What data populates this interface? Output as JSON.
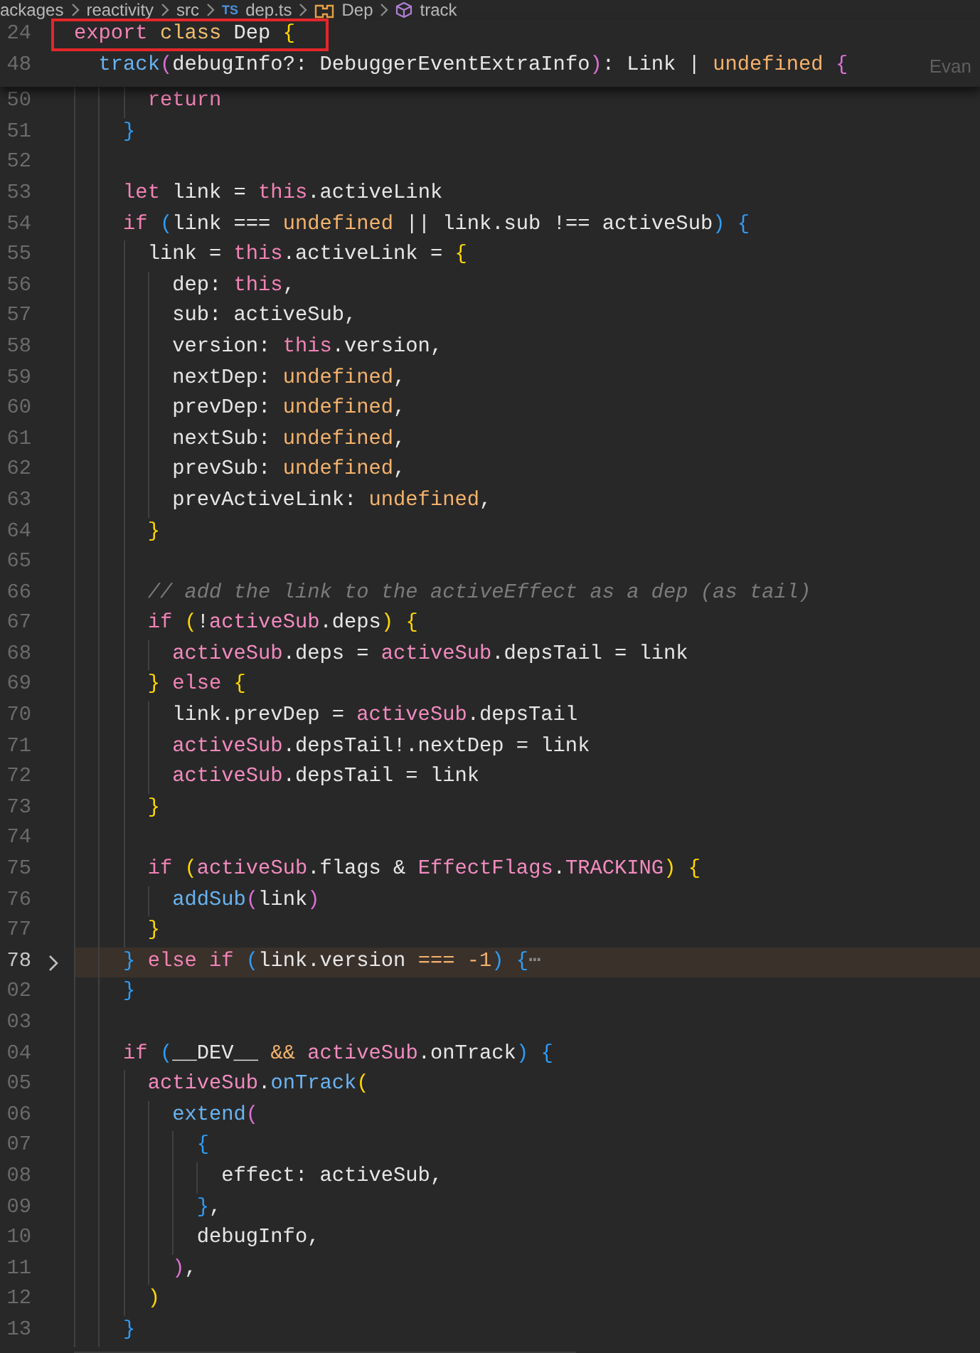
{
  "breadcrumb": [
    {
      "label": "ackages",
      "kind": "folder"
    },
    {
      "label": "reactivity",
      "kind": "folder"
    },
    {
      "label": "src",
      "kind": "folder"
    },
    {
      "label": "dep.ts",
      "kind": "file",
      "badge": "TS"
    },
    {
      "label": "Dep",
      "kind": "class"
    },
    {
      "label": "track",
      "kind": "method"
    }
  ],
  "sticky_lines": [
    {
      "number": "24",
      "boxed": true,
      "tokens": [
        {
          "text": "export ",
          "kind": "kw"
        },
        {
          "text": "class ",
          "kind": "st"
        },
        {
          "text": "Dep ",
          "kind": "p"
        },
        {
          "text": "{",
          "kind": "b1"
        }
      ]
    },
    {
      "number": "48",
      "boxed": false,
      "blame": "Evan",
      "tokens": [
        {
          "text": "  track",
          "kind": "fn"
        },
        {
          "text": "(",
          "kind": "b2"
        },
        {
          "text": "debugInfo?: DebuggerEventExtraInfo",
          "kind": "p"
        },
        {
          "text": ")",
          "kind": "b2"
        },
        {
          "text": ": Link | ",
          "kind": "p"
        },
        {
          "text": "undefined ",
          "kind": "c"
        },
        {
          "text": "{",
          "kind": "b2"
        }
      ]
    }
  ],
  "lines": [
    {
      "number": "50",
      "folded": false,
      "current": false,
      "tokens": [
        {
          "text": "      return",
          "kind": "kw"
        }
      ]
    },
    {
      "number": "51",
      "folded": false,
      "current": false,
      "tokens": [
        {
          "text": "    }",
          "kind": "b3"
        }
      ]
    },
    {
      "number": "52",
      "folded": false,
      "current": false
    },
    {
      "number": "53",
      "folded": false,
      "current": false,
      "tokens": [
        {
          "text": "    let ",
          "kind": "kw"
        },
        {
          "text": "link = ",
          "kind": "p"
        },
        {
          "text": "this",
          "kind": "kw"
        },
        {
          "text": ".activeLink",
          "kind": "p"
        }
      ]
    },
    {
      "number": "54",
      "folded": false,
      "current": false,
      "tokens": [
        {
          "text": "    if ",
          "kind": "kw"
        },
        {
          "text": "(",
          "kind": "b3"
        },
        {
          "text": "link === ",
          "kind": "p"
        },
        {
          "text": "undefined",
          "kind": "c"
        },
        {
          "text": " || link.sub !== activeSub",
          "kind": "p"
        },
        {
          "text": ") {",
          "kind": "b3"
        }
      ]
    },
    {
      "number": "55",
      "folded": false,
      "current": false,
      "tokens": [
        {
          "text": "      link = ",
          "kind": "p"
        },
        {
          "text": "this",
          "kind": "kw"
        },
        {
          "text": ".activeLink = ",
          "kind": "p"
        },
        {
          "text": "{",
          "kind": "b1"
        }
      ]
    },
    {
      "number": "56",
      "folded": false,
      "current": false,
      "tokens": [
        {
          "text": "        dep: ",
          "kind": "p"
        },
        {
          "text": "this",
          "kind": "kw"
        },
        {
          "text": ",",
          "kind": "p"
        }
      ]
    },
    {
      "number": "57",
      "folded": false,
      "current": false,
      "tokens": [
        {
          "text": "        sub: activeSub,",
          "kind": "p"
        }
      ]
    },
    {
      "number": "58",
      "folded": false,
      "current": false,
      "tokens": [
        {
          "text": "        version: ",
          "kind": "p"
        },
        {
          "text": "this",
          "kind": "kw"
        },
        {
          "text": ".version,",
          "kind": "p"
        }
      ]
    },
    {
      "number": "59",
      "folded": false,
      "current": false,
      "tokens": [
        {
          "text": "        nextDep: ",
          "kind": "p"
        },
        {
          "text": "undefined",
          "kind": "c"
        },
        {
          "text": ",",
          "kind": "p"
        }
      ]
    },
    {
      "number": "60",
      "folded": false,
      "current": false,
      "tokens": [
        {
          "text": "        prevDep: ",
          "kind": "p"
        },
        {
          "text": "undefined",
          "kind": "c"
        },
        {
          "text": ",",
          "kind": "p"
        }
      ]
    },
    {
      "number": "61",
      "folded": false,
      "current": false,
      "tokens": [
        {
          "text": "        nextSub: ",
          "kind": "p"
        },
        {
          "text": "undefined",
          "kind": "c"
        },
        {
          "text": ",",
          "kind": "p"
        }
      ]
    },
    {
      "number": "62",
      "folded": false,
      "current": false,
      "tokens": [
        {
          "text": "        prevSub: ",
          "kind": "p"
        },
        {
          "text": "undefined",
          "kind": "c"
        },
        {
          "text": ",",
          "kind": "p"
        }
      ]
    },
    {
      "number": "63",
      "folded": false,
      "current": false,
      "tokens": [
        {
          "text": "        prevActiveLink: ",
          "kind": "p"
        },
        {
          "text": "undefined",
          "kind": "c"
        },
        {
          "text": ",",
          "kind": "p"
        }
      ]
    },
    {
      "number": "64",
      "folded": false,
      "current": false,
      "tokens": [
        {
          "text": "      }",
          "kind": "b1"
        }
      ]
    },
    {
      "number": "65",
      "folded": false,
      "current": false
    },
    {
      "number": "66",
      "folded": false,
      "current": false,
      "tokens": [
        {
          "text": "      // add the link to the activeEffect as a dep (as tail)",
          "kind": "cm"
        }
      ]
    },
    {
      "number": "67",
      "folded": false,
      "current": false,
      "tokens": [
        {
          "text": "      if ",
          "kind": "kw"
        },
        {
          "text": "(",
          "kind": "b1"
        },
        {
          "text": "!",
          "kind": "p"
        },
        {
          "text": "activeSub",
          "kind": "v"
        },
        {
          "text": ".deps",
          "kind": "p"
        },
        {
          "text": ") {",
          "kind": "b1"
        }
      ]
    },
    {
      "number": "68",
      "folded": false,
      "current": false,
      "tokens": [
        {
          "text": "        activeSub",
          "kind": "v"
        },
        {
          "text": ".deps = ",
          "kind": "p"
        },
        {
          "text": "activeSub",
          "kind": "v"
        },
        {
          "text": ".depsTail = link",
          "kind": "p"
        }
      ]
    },
    {
      "number": "69",
      "folded": false,
      "current": false,
      "tokens": [
        {
          "text": "      } ",
          "kind": "b1"
        },
        {
          "text": "else ",
          "kind": "kw"
        },
        {
          "text": "{",
          "kind": "b1"
        }
      ]
    },
    {
      "number": "70",
      "folded": false,
      "current": false,
      "tokens": [
        {
          "text": "        link.prevDep = ",
          "kind": "p"
        },
        {
          "text": "activeSub",
          "kind": "v"
        },
        {
          "text": ".depsTail",
          "kind": "p"
        }
      ]
    },
    {
      "number": "71",
      "folded": false,
      "current": false,
      "tokens": [
        {
          "text": "        activeSub",
          "kind": "v"
        },
        {
          "text": ".depsTail!.nextDep = link",
          "kind": "p"
        }
      ]
    },
    {
      "number": "72",
      "folded": false,
      "current": false,
      "tokens": [
        {
          "text": "        activeSub",
          "kind": "v"
        },
        {
          "text": ".depsTail = link",
          "kind": "p"
        }
      ]
    },
    {
      "number": "73",
      "folded": false,
      "current": false,
      "tokens": [
        {
          "text": "      }",
          "kind": "b1"
        }
      ]
    },
    {
      "number": "74",
      "folded": false,
      "current": false
    },
    {
      "number": "75",
      "folded": false,
      "current": false,
      "tokens": [
        {
          "text": "      if ",
          "kind": "kw"
        },
        {
          "text": "(",
          "kind": "b1"
        },
        {
          "text": "activeSub",
          "kind": "v"
        },
        {
          "text": ".flags & ",
          "kind": "p"
        },
        {
          "text": "EffectFlags",
          "kind": "v"
        },
        {
          "text": ".",
          "kind": "p"
        },
        {
          "text": "TRACKING",
          "kind": "v"
        },
        {
          "text": ") {",
          "kind": "b1"
        }
      ]
    },
    {
      "number": "76",
      "folded": false,
      "current": false,
      "tokens": [
        {
          "text": "        addSub",
          "kind": "fn"
        },
        {
          "text": "(",
          "kind": "b2"
        },
        {
          "text": "link",
          "kind": "p"
        },
        {
          "text": ")",
          "kind": "b2"
        }
      ]
    },
    {
      "number": "77",
      "folded": false,
      "current": false,
      "tokens": [
        {
          "text": "      }",
          "kind": "b1"
        }
      ]
    },
    {
      "number": "78",
      "folded": true,
      "current": true,
      "tokens": [
        {
          "text": "    } ",
          "kind": "b3"
        },
        {
          "text": "else if ",
          "kind": "kw"
        },
        {
          "text": "(",
          "kind": "b3"
        },
        {
          "text": "link.version ",
          "kind": "p"
        },
        {
          "text": "=== -1",
          "kind": "c"
        },
        {
          "text": ") {",
          "kind": "b3"
        },
        {
          "text": "⋯",
          "kind": "fd"
        }
      ]
    },
    {
      "number": "02",
      "folded": false,
      "current": false,
      "tokens": [
        {
          "text": "    }",
          "kind": "b3"
        }
      ]
    },
    {
      "number": "03",
      "folded": false,
      "current": false
    },
    {
      "number": "04",
      "folded": false,
      "current": false,
      "tokens": [
        {
          "text": "    if ",
          "kind": "kw"
        },
        {
          "text": "(",
          "kind": "b3"
        },
        {
          "text": "__DEV__ ",
          "kind": "p"
        },
        {
          "text": "&& ",
          "kind": "c"
        },
        {
          "text": "activeSub",
          "kind": "v"
        },
        {
          "text": ".onTrack",
          "kind": "p"
        },
        {
          "text": ") {",
          "kind": "b3"
        }
      ]
    },
    {
      "number": "05",
      "folded": false,
      "current": false,
      "tokens": [
        {
          "text": "      activeSub",
          "kind": "v"
        },
        {
          "text": ".",
          "kind": "p"
        },
        {
          "text": "onTrack",
          "kind": "fn"
        },
        {
          "text": "(",
          "kind": "b1"
        }
      ]
    },
    {
      "number": "06",
      "folded": false,
      "current": false,
      "tokens": [
        {
          "text": "        extend",
          "kind": "fn"
        },
        {
          "text": "(",
          "kind": "b2"
        }
      ]
    },
    {
      "number": "07",
      "folded": false,
      "current": false,
      "tokens": [
        {
          "text": "          {",
          "kind": "b3"
        }
      ]
    },
    {
      "number": "08",
      "folded": false,
      "current": false,
      "tokens": [
        {
          "text": "            effect: activeSub,",
          "kind": "p"
        }
      ]
    },
    {
      "number": "09",
      "folded": false,
      "current": false,
      "tokens": [
        {
          "text": "          }",
          "kind": "b3"
        },
        {
          "text": ",",
          "kind": "p"
        }
      ]
    },
    {
      "number": "10",
      "folded": false,
      "current": false,
      "tokens": [
        {
          "text": "          debugInfo,",
          "kind": "p"
        }
      ]
    },
    {
      "number": "11",
      "folded": false,
      "current": false,
      "tokens": [
        {
          "text": "        )",
          "kind": "b2"
        },
        {
          "text": ",",
          "kind": "p"
        }
      ]
    },
    {
      "number": "12",
      "folded": false,
      "current": false,
      "tokens": [
        {
          "text": "      )",
          "kind": "b1"
        }
      ]
    },
    {
      "number": "13",
      "folded": false,
      "current": false,
      "tokens": [
        {
          "text": "    }",
          "kind": "b3"
        }
      ]
    }
  ]
}
